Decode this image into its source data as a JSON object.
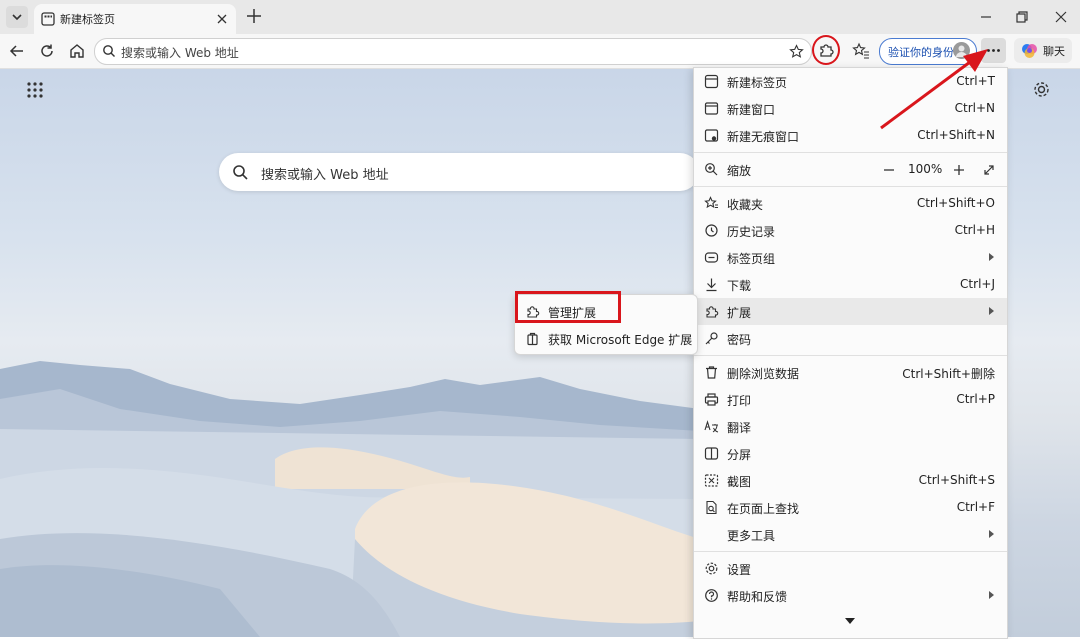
{
  "tab": {
    "title": "新建标签页"
  },
  "toolbar": {
    "address_placeholder": "搜索或输入 Web 地址",
    "verify_label": "验证你的身份",
    "chat_label": "聊天"
  },
  "newtab": {
    "search_placeholder": "搜索或输入 Web 地址"
  },
  "menu": {
    "new_tab": {
      "label": "新建标签页",
      "shortcut": "Ctrl+T"
    },
    "new_window": {
      "label": "新建窗口",
      "shortcut": "Ctrl+N"
    },
    "inprivate": {
      "label": "新建无痕窗口",
      "shortcut": "Ctrl+Shift+N"
    },
    "zoom": {
      "label": "缩放",
      "value": "100%"
    },
    "favorites": {
      "label": "收藏夹",
      "shortcut": "Ctrl+Shift+O"
    },
    "history": {
      "label": "历史记录",
      "shortcut": "Ctrl+H"
    },
    "tab_groups": {
      "label": "标签页组"
    },
    "downloads": {
      "label": "下载",
      "shortcut": "Ctrl+J"
    },
    "extensions": {
      "label": "扩展"
    },
    "passwords": {
      "label": "密码"
    },
    "clear_data": {
      "label": "删除浏览数据",
      "shortcut": "Ctrl+Shift+删除"
    },
    "print": {
      "label": "打印",
      "shortcut": "Ctrl+P"
    },
    "translate": {
      "label": "翻译"
    },
    "split_screen": {
      "label": "分屏"
    },
    "screenshot": {
      "label": "截图",
      "shortcut": "Ctrl+Shift+S"
    },
    "find": {
      "label": "在页面上查找",
      "shortcut": "Ctrl+F"
    },
    "more_tools": {
      "label": "更多工具"
    },
    "settings": {
      "label": "设置"
    },
    "help": {
      "label": "帮助和反馈"
    }
  },
  "submenu": {
    "manage": {
      "label": "管理扩展"
    },
    "get": {
      "label": "获取 Microsoft Edge 扩展"
    }
  },
  "colors": {
    "accent": "#1a4fb0",
    "annotation": "#d9161c"
  }
}
